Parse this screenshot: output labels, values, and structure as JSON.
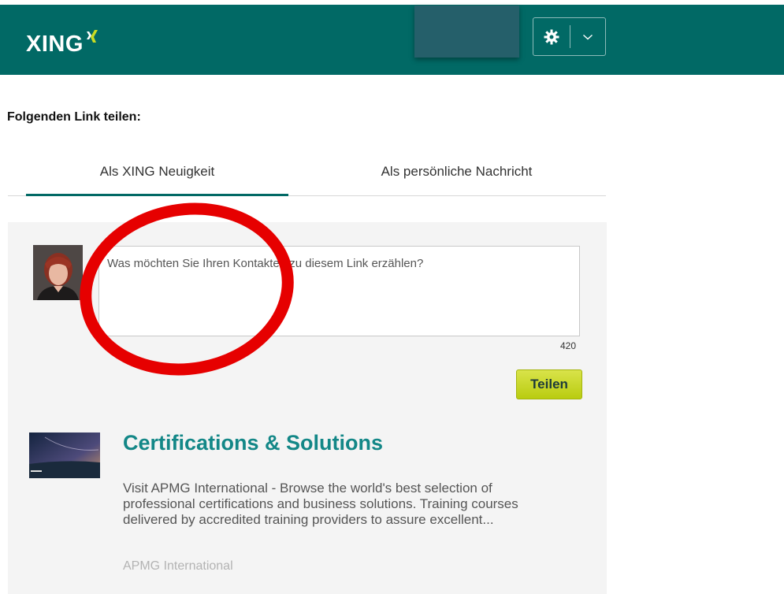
{
  "header": {
    "logo_text": "XING",
    "brand_color": "#016965",
    "accent_color": "#c8dc23",
    "settings_icon": "gear-icon",
    "dropdown_icon": "chevron-down-icon"
  },
  "share": {
    "title": "Folgenden Link teilen:",
    "tabs": [
      {
        "label": "Als XING Neuigkeit",
        "active": true
      },
      {
        "label": "Als persönliche Nachricht",
        "active": false
      }
    ],
    "textarea_placeholder": "Was möchten Sie Ihren Kontakten zu diesem Link erzählen?",
    "char_counter": "420",
    "submit_label": "Teilen"
  },
  "link_preview": {
    "title": "Certifications & Solutions",
    "description": "Visit APMG International - Browse the world's best selection of professional certifications and business solutions. Training courses delivered by accredited training providers to assure excellent...",
    "source": "APMG International",
    "title_color": "#138787"
  },
  "annotation": {
    "ring_color": "#e60000"
  }
}
